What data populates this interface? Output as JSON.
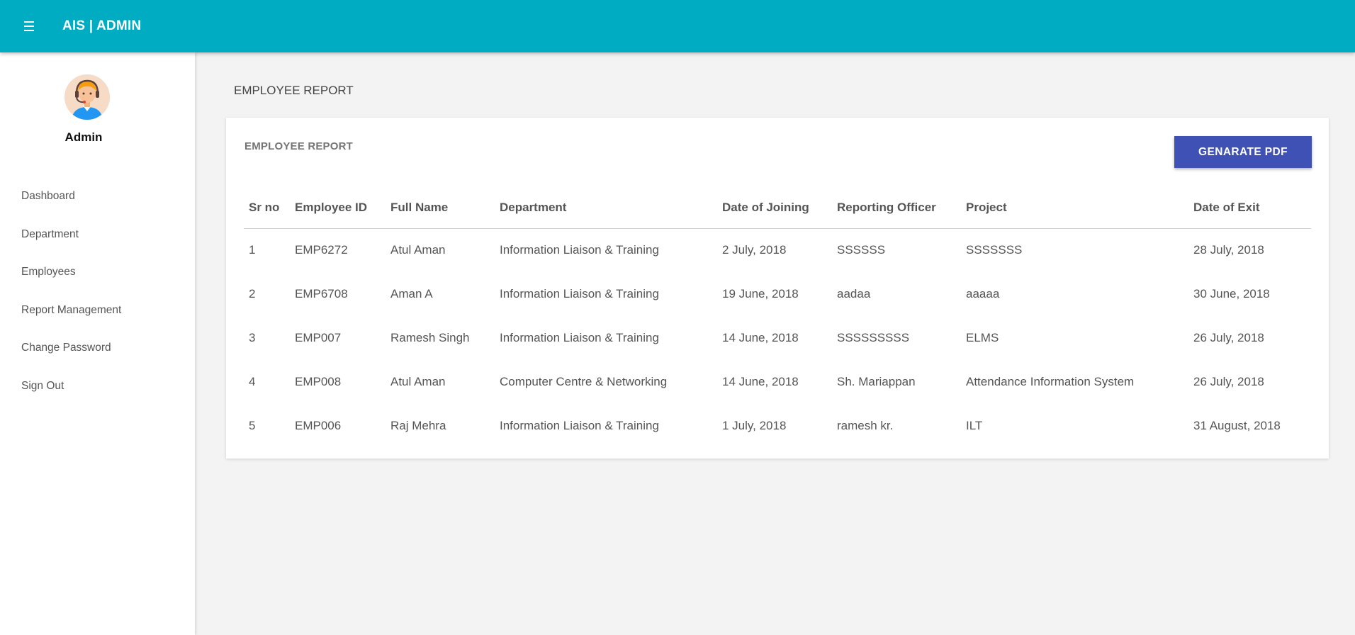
{
  "header": {
    "brand": "AIS | ADMIN"
  },
  "sidebar": {
    "user_name": "Admin",
    "items": [
      {
        "label": "Dashboard"
      },
      {
        "label": "Department"
      },
      {
        "label": "Employees"
      },
      {
        "label": "Report Management"
      },
      {
        "label": "Change Password"
      },
      {
        "label": "Sign Out"
      }
    ]
  },
  "main": {
    "page_title": "EMPLOYEE REPORT",
    "card_title": "EMPLOYEE REPORT",
    "pdf_button": "GENARATE PDF",
    "table": {
      "headers": [
        "Sr no",
        "Employee ID",
        "Full Name",
        "Department",
        "Date of Joining",
        "Reporting Officer",
        "Project",
        "Date of Exit"
      ],
      "rows": [
        [
          "1",
          "EMP6272",
          "Atul Aman",
          "Information Liaison & Training",
          "2 July, 2018",
          "SSSSSS",
          "SSSSSSS",
          "28 July, 2018"
        ],
        [
          "2",
          "EMP6708",
          "Aman A",
          "Information Liaison & Training",
          "19 June, 2018",
          "aadaa",
          "aaaaa",
          "30 June, 2018"
        ],
        [
          "3",
          "EMP007",
          "Ramesh Singh",
          "Information Liaison & Training",
          "14 June, 2018",
          "SSSSSSSSS",
          "ELMS",
          "26 July, 2018"
        ],
        [
          "4",
          "EMP008",
          "Atul Aman",
          "Computer Centre & Networking",
          "14 June, 2018",
          "Sh. Mariappan",
          "Attendance Information System",
          "26 July, 2018"
        ],
        [
          "5",
          "EMP006",
          "Raj Mehra",
          "Information Liaison & Training",
          "1 July, 2018",
          "ramesh kr.",
          "ILT",
          "31 August, 2018"
        ]
      ]
    }
  }
}
